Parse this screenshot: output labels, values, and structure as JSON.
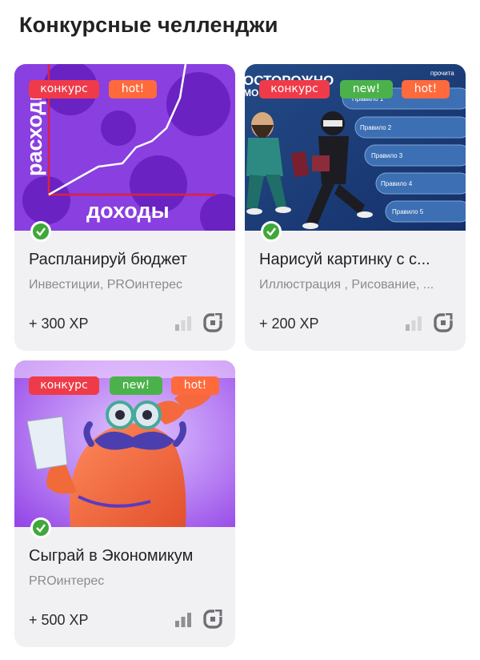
{
  "page": {
    "title": "Конкурсные челленджи"
  },
  "cards": [
    {
      "title": "Распланируй бюджет",
      "tags": "Инвестиции, PROинтерес",
      "xp": "+ 300 XP",
      "badges": {
        "contest": "конкурс",
        "hot": "hot!"
      },
      "image_text": {
        "ylabel": "расходы",
        "xlabel": "доходы"
      },
      "completed": true,
      "level_bars_filled": 1
    },
    {
      "title": "Нарисуй картинку с с...",
      "tags": "Иллюстрация , Рисование, ...",
      "xp": "+ 200 XP",
      "badges": {
        "contest": "конкурс",
        "new": "new!",
        "hot": "hot!"
      },
      "image_text": {
        "headline": "ОСТОРОЖНО",
        "headline_2": "МО",
        "side_note": "прочита",
        "rules": [
          "Правило 1",
          "Правило 2",
          "Правило 3",
          "Правило 4",
          "Правило 5"
        ]
      },
      "completed": true,
      "level_bars_filled": 1
    },
    {
      "title": "Сыграй в Экономикум",
      "tags": "PROинтерес",
      "xp": "+ 500 XP",
      "badges": {
        "contest": "конкурс",
        "new": "new!",
        "hot": "hot!"
      },
      "completed": true,
      "level_bars_filled": 3
    }
  ],
  "colors": {
    "contest": "#ef3b49",
    "hot": "#ff6a3c",
    "new": "#4bb24b",
    "check": "#3fa83a",
    "card_bg": "#f1f1f4"
  }
}
